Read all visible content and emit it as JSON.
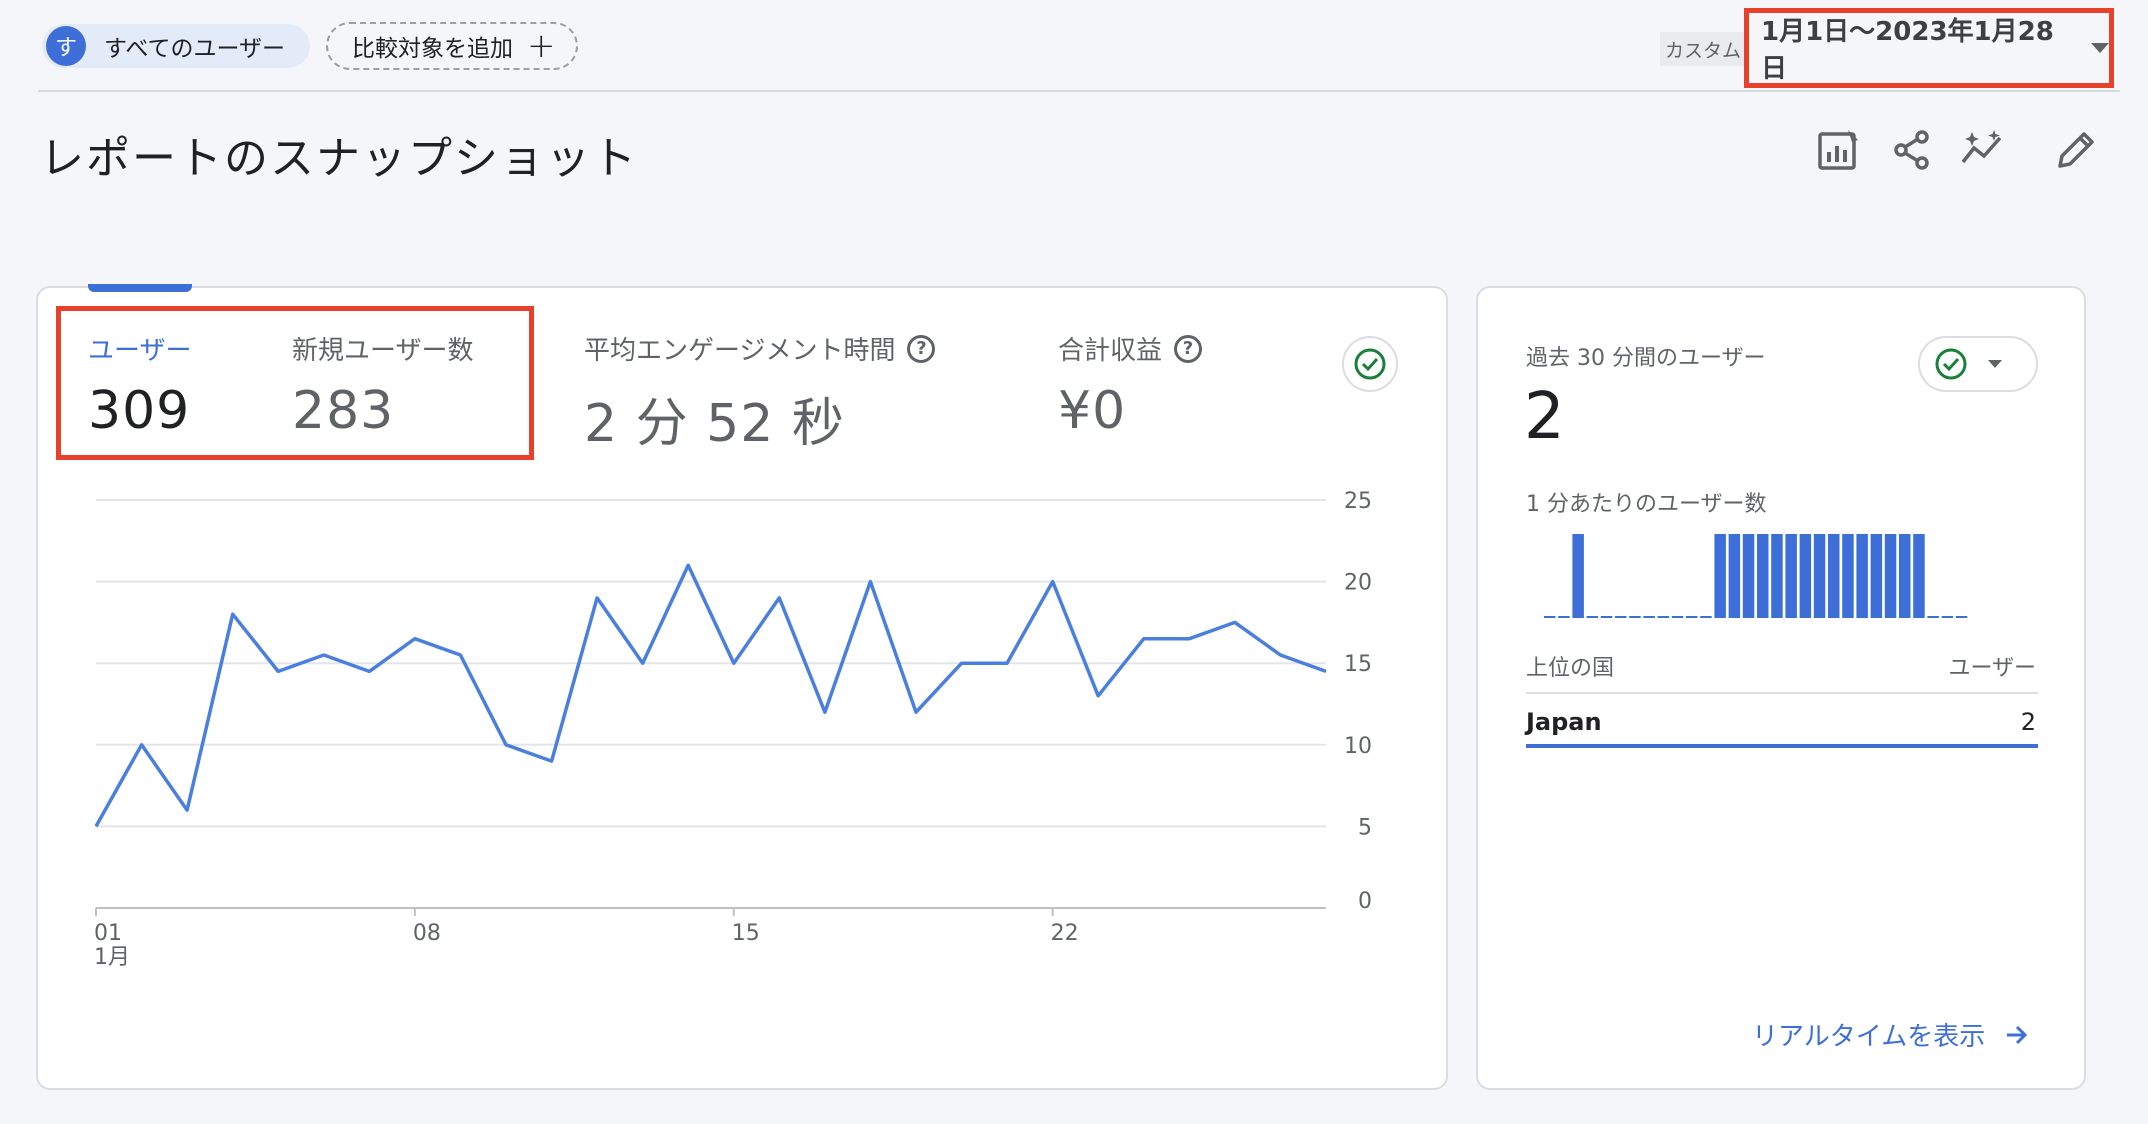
{
  "header": {
    "user_avatar_letter": "す",
    "user_segment": "すべてのユーザー",
    "compare_label": "比較対象を追加",
    "compare_plus": "+",
    "date_mode": "カスタム",
    "date_range": "1月1日〜2023年1月28日"
  },
  "page": {
    "title": "レポートのスナップショット"
  },
  "toolbar": {
    "icons": [
      "customize-report-icon",
      "share-icon",
      "insights-icon",
      "edit-icon"
    ]
  },
  "metrics": [
    {
      "label": "ユーザー",
      "value": "309",
      "active": true
    },
    {
      "label": "新規ユーザー数",
      "value": "283",
      "active": false
    },
    {
      "label": "平均エンゲージメント時間",
      "value": "2 分 52 秒",
      "active": false,
      "help": "?"
    },
    {
      "label": "合計収益",
      "value": "¥0",
      "active": false,
      "help": "?"
    }
  ],
  "chart_data": {
    "type": "line",
    "x_tick_labels": [
      "01",
      "08",
      "15",
      "22"
    ],
    "x_tick_sublabel": "1月",
    "y_tick_labels": [
      "0",
      "5",
      "10",
      "15",
      "20",
      "25"
    ],
    "ylim": [
      0,
      25
    ],
    "grid": true,
    "series": [
      {
        "color": "#4a7fe0",
        "values": [
          5,
          10,
          6,
          18,
          14.5,
          15.5,
          14.5,
          16.5,
          15.5,
          10,
          9,
          19,
          15,
          21,
          15,
          19,
          12,
          20,
          12,
          15,
          15,
          20,
          13,
          16.5,
          16.5,
          17.5,
          15.5,
          14.5
        ]
      }
    ]
  },
  "realtime": {
    "title": "過去 30 分間のユーザー",
    "count": "2",
    "per_minute_label": "1 分あたりのユーザー数",
    "per_minute_values": [
      0,
      0,
      1,
      0,
      0,
      0,
      0,
      0,
      0,
      0,
      0,
      0,
      1,
      1,
      1,
      1,
      1,
      1,
      1,
      1,
      1,
      1,
      1,
      1,
      1,
      1,
      1,
      0,
      0,
      0
    ],
    "country_header": "上位の国",
    "users_header": "ユーザー",
    "countries": [
      {
        "name": "Japan",
        "users": "2"
      }
    ],
    "link_label": "リアルタイムを表示",
    "accent": "#3e6fd8"
  }
}
